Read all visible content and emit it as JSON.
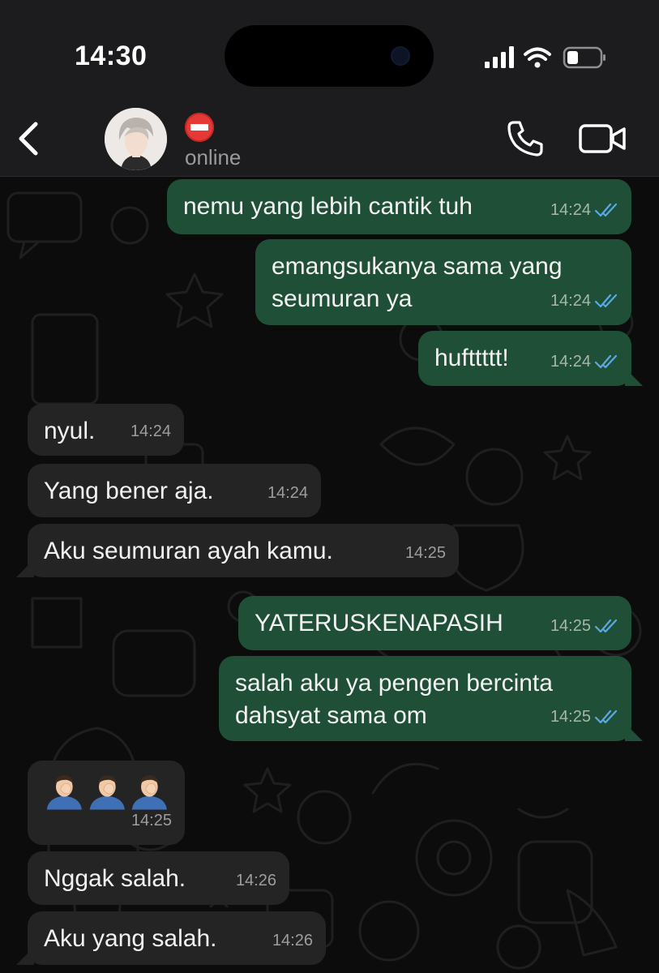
{
  "status_bar": {
    "time": "14:30"
  },
  "header": {
    "contact_status": "online"
  },
  "messages": [
    {
      "dir": "out",
      "text": "nemu yang lebih cantik tuh",
      "time": "14:24",
      "read": true
    },
    {
      "dir": "out",
      "text": "emangsukanya sama yang\nseumuran ya",
      "time": "14:24",
      "read": true
    },
    {
      "dir": "out",
      "text": "hufttttt!",
      "time": "14:24",
      "read": true
    },
    {
      "dir": "in",
      "text": "nyul.",
      "time": "14:24"
    },
    {
      "dir": "in",
      "text": "Yang bener aja.",
      "time": "14:24"
    },
    {
      "dir": "in",
      "text": "Aku seumuran ayah kamu.",
      "time": "14:25"
    },
    {
      "dir": "out",
      "text": "YATERUSKENAPASIH",
      "time": "14:25",
      "read": true
    },
    {
      "dir": "out",
      "text": "salah aku ya pengen bercinta\ndahsyat sama om",
      "time": "14:25",
      "read": true
    },
    {
      "dir": "in",
      "text": "",
      "emoji": [
        "man-facepalming",
        "man-facepalming",
        "man-facepalming"
      ],
      "time": "14:25"
    },
    {
      "dir": "in",
      "text": "Nggak salah.",
      "time": "14:26"
    },
    {
      "dir": "in",
      "text": "Aku yang salah.",
      "time": "14:26"
    }
  ],
  "colors": {
    "outgoing_bubble": "#1f4f36",
    "incoming_bubble": "#242424",
    "read_ticks": "#5aa9e6",
    "header_bg": "#1c1c1e"
  },
  "icons": {
    "back": "chevron-left-icon",
    "call": "phone-icon",
    "video": "video-camera-icon",
    "contact_name_emoji": "no-entry-emoji"
  }
}
